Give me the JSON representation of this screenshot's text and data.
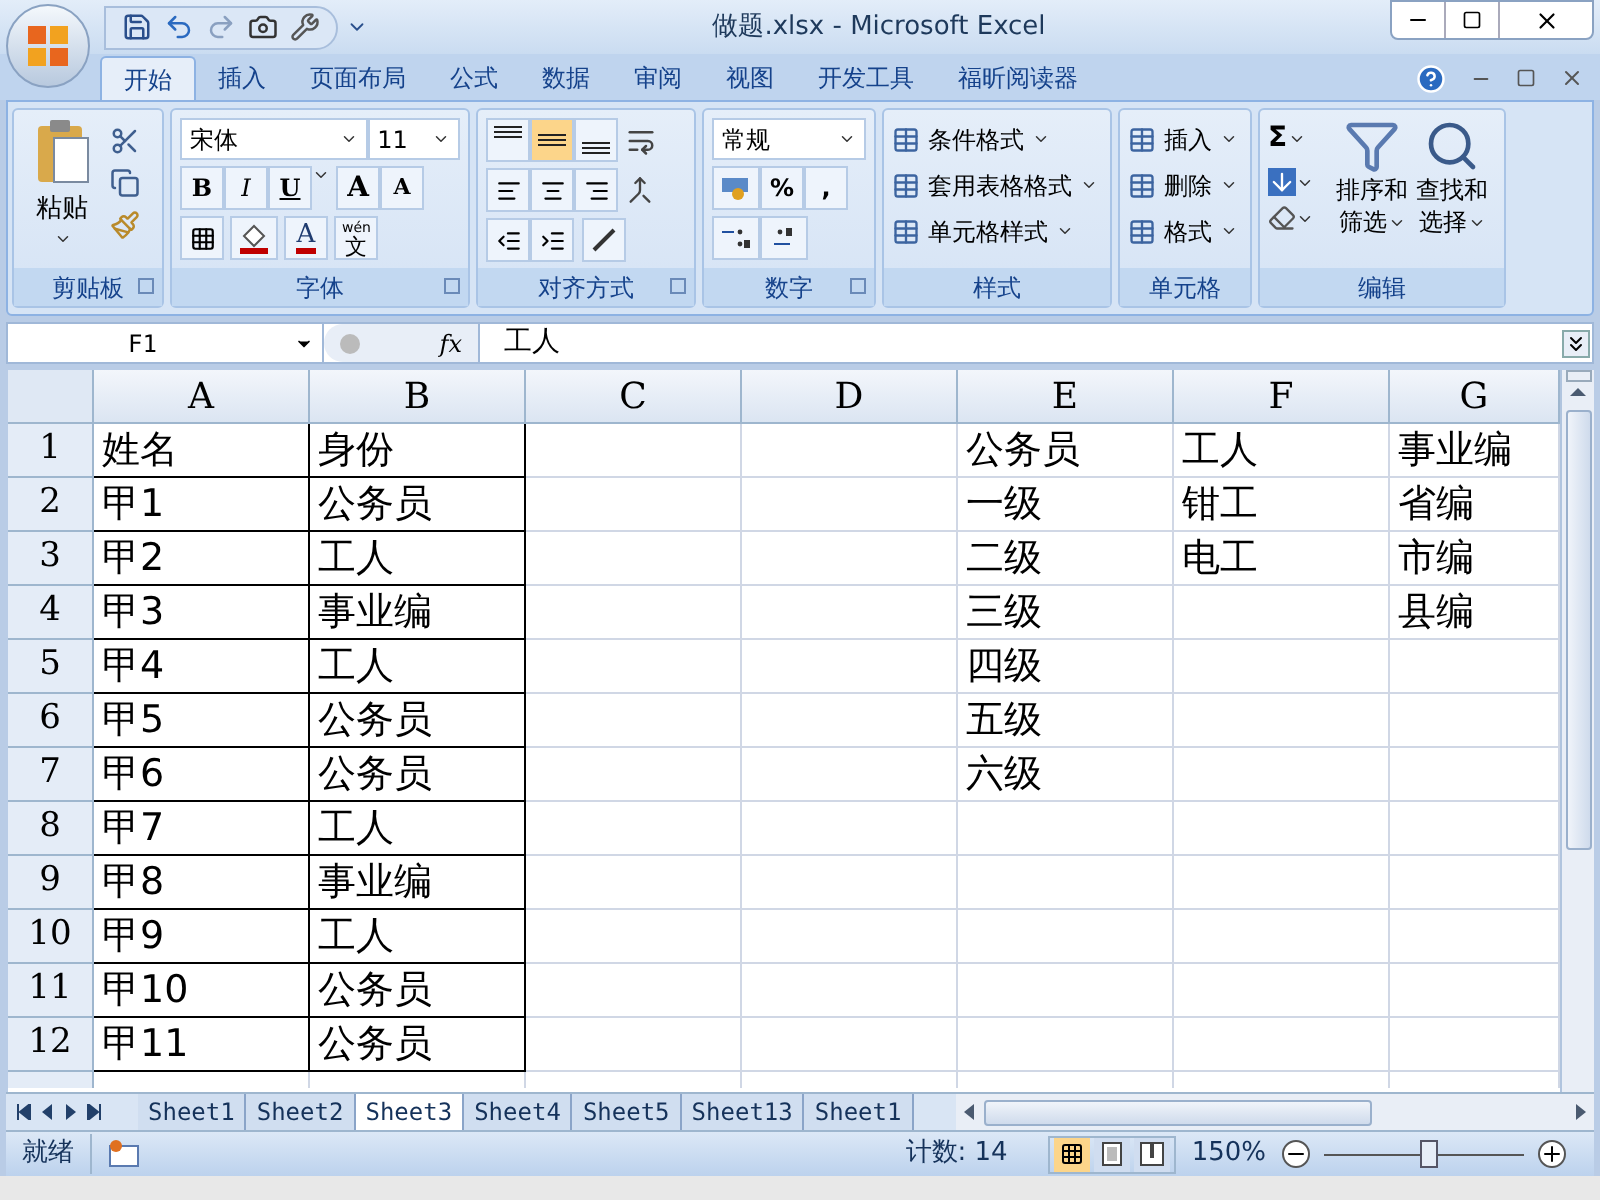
{
  "window": {
    "title": "做题.xlsx - Microsoft Excel"
  },
  "ribbon": {
    "tabs": [
      {
        "label": "开始",
        "selected": true
      },
      {
        "label": "插入",
        "selected": false
      },
      {
        "label": "页面布局",
        "selected": false
      },
      {
        "label": "公式",
        "selected": false
      },
      {
        "label": "数据",
        "selected": false
      },
      {
        "label": "审阅",
        "selected": false
      },
      {
        "label": "视图",
        "selected": false
      },
      {
        "label": "开发工具",
        "selected": false
      },
      {
        "label": "福昕阅读器",
        "selected": false
      }
    ],
    "groups": [
      {
        "kind": "clipboard",
        "label": "剪贴板",
        "paste": "粘贴"
      },
      {
        "kind": "font",
        "label": "字体",
        "font_name": "宋体",
        "font_size": "11",
        "style_buttons": [
          "B",
          "I",
          "U"
        ],
        "size_buttons": [
          "A",
          "A"
        ],
        "font_color": "A",
        "phonetic_top": "wén",
        "phonetic": "文"
      },
      {
        "kind": "alignment",
        "label": "对齐方式",
        "vertical": [
          {
            "kind": "top",
            "selected": false
          },
          {
            "kind": "middle",
            "selected": true
          },
          {
            "kind": "bottom",
            "selected": false
          }
        ]
      },
      {
        "kind": "number",
        "label": "数字",
        "format": "常规",
        "buttons": [
          "%",
          ","
        ]
      },
      {
        "kind": "styles",
        "label": "样式",
        "items": [
          "条件格式",
          "套用表格格式",
          "单元格样式"
        ]
      },
      {
        "kind": "cells",
        "label": "单元格",
        "items": [
          "插入",
          "删除",
          "格式"
        ]
      },
      {
        "kind": "editing",
        "label": "编辑",
        "sum": "Σ",
        "sort": [
          "排序和",
          "筛选"
        ],
        "find": [
          "查找和",
          "选择"
        ]
      }
    ]
  },
  "formula_bar": {
    "name_box": "F1",
    "fx": "fx",
    "value": "工人"
  },
  "columns": [
    "A",
    "B",
    "C",
    "D",
    "E",
    "F",
    "G"
  ],
  "rows": [
    {
      "number": "1",
      "cells": {
        "A": {
          "text": "姓名",
          "border": true
        },
        "B": {
          "text": "身份",
          "border": true
        },
        "E": {
          "text": "公务员"
        },
        "F": {
          "text": "工人"
        },
        "G": {
          "text": "事业编"
        }
      }
    },
    {
      "number": "2",
      "cells": {
        "A": {
          "text": "甲1",
          "border": true
        },
        "B": {
          "text": "公务员",
          "border": true
        },
        "E": {
          "text": "一级"
        },
        "F": {
          "text": "钳工"
        },
        "G": {
          "text": "省编"
        }
      }
    },
    {
      "number": "3",
      "cells": {
        "A": {
          "text": "甲2",
          "border": true
        },
        "B": {
          "text": "工人",
          "border": true
        },
        "E": {
          "text": "二级"
        },
        "F": {
          "text": "电工"
        },
        "G": {
          "text": "市编"
        }
      }
    },
    {
      "number": "4",
      "cells": {
        "A": {
          "text": "甲3",
          "border": true
        },
        "B": {
          "text": "事业编",
          "border": true
        },
        "E": {
          "text": "三级"
        },
        "G": {
          "text": "县编"
        }
      }
    },
    {
      "number": "5",
      "cells": {
        "A": {
          "text": "甲4",
          "border": true
        },
        "B": {
          "text": "工人",
          "border": true
        },
        "E": {
          "text": "四级"
        }
      }
    },
    {
      "number": "6",
      "cells": {
        "A": {
          "text": "甲5",
          "border": true
        },
        "B": {
          "text": "公务员",
          "border": true
        },
        "E": {
          "text": "五级"
        }
      }
    },
    {
      "number": "7",
      "cells": {
        "A": {
          "text": "甲6",
          "border": true
        },
        "B": {
          "text": "公务员",
          "border": true
        },
        "E": {
          "text": "六级"
        }
      }
    },
    {
      "number": "8",
      "cells": {
        "A": {
          "text": "甲7",
          "border": true
        },
        "B": {
          "text": "工人",
          "border": true
        }
      }
    },
    {
      "number": "9",
      "cells": {
        "A": {
          "text": "甲8",
          "border": true
        },
        "B": {
          "text": "事业编",
          "border": true
        }
      }
    },
    {
      "number": "10",
      "cells": {
        "A": {
          "text": "甲9",
          "border": true
        },
        "B": {
          "text": "工人",
          "border": true
        }
      }
    },
    {
      "number": "11",
      "cells": {
        "A": {
          "text": "甲10",
          "border": true
        },
        "B": {
          "text": "公务员",
          "border": true
        }
      }
    },
    {
      "number": "12",
      "cells": {
        "A": {
          "text": "甲11",
          "border": true
        },
        "B": {
          "text": "公务员",
          "border": true
        }
      }
    }
  ],
  "sheet_tabs": [
    {
      "label": "Sheet1",
      "selected": false
    },
    {
      "label": "Sheet2",
      "selected": false
    },
    {
      "label": "Sheet3",
      "selected": true
    },
    {
      "label": "Sheet4",
      "selected": false
    },
    {
      "label": "Sheet5",
      "selected": false
    },
    {
      "label": "Sheet13",
      "selected": false
    },
    {
      "label": "Sheet1",
      "selected": false
    }
  ],
  "status_bar": {
    "mode": "就绪",
    "count": "计数: 14",
    "views": [
      {
        "kind": "normal",
        "selected": true
      },
      {
        "kind": "layout",
        "selected": false
      },
      {
        "kind": "break",
        "selected": false
      }
    ],
    "zoom": "150%",
    "zoom_slider": {
      "level": 0.52
    }
  }
}
